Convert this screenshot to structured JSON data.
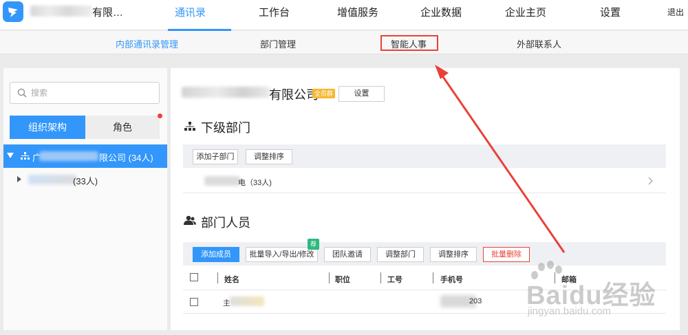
{
  "topnav": {
    "company_name_suffix": "有限…",
    "items": [
      "通讯录",
      "工作台",
      "增值服务",
      "企业数据",
      "企业主页",
      "设置"
    ],
    "active": "通讯录",
    "logout": "退出"
  },
  "subnav": {
    "items": [
      "内部通讯录管理",
      "部门管理",
      "智能人事",
      "外部联系人"
    ],
    "active": "内部通讯录管理",
    "highlighted": "智能人事"
  },
  "left": {
    "search_placeholder": "搜索",
    "segments": [
      "组织架构",
      "角色"
    ],
    "tree": {
      "root_lead": "广",
      "root_suffix": "限公司 (34人)",
      "child_suffix": "(33人)"
    }
  },
  "main": {
    "company_suffix": "有限公司",
    "badge": "全员群",
    "settings_button": "设置",
    "sub_dept_title": "下级部门",
    "sub_dept_buttons": [
      "添加子部门",
      "调整排序"
    ],
    "sub_dept_row": "电（33人)",
    "members_title": "部门人员",
    "member_buttons": [
      "添加成员",
      "批量导入/导出/修改",
      "团队邀请",
      "调整部门",
      "调整排序",
      "批量删除"
    ],
    "recommend_badge": "荐",
    "columns": [
      "姓名",
      "职位",
      "工号",
      "手机号",
      "邮箱"
    ],
    "row_name_lead": "主",
    "row_phone_end": "203"
  },
  "watermark": {
    "brand": "Baidu经验",
    "url": "jingyan.baidu.com"
  },
  "colors": {
    "accent": "#3296fa",
    "highlight": "#e8413a",
    "badge": "#f5b82e",
    "recommend": "#2fb87d"
  }
}
